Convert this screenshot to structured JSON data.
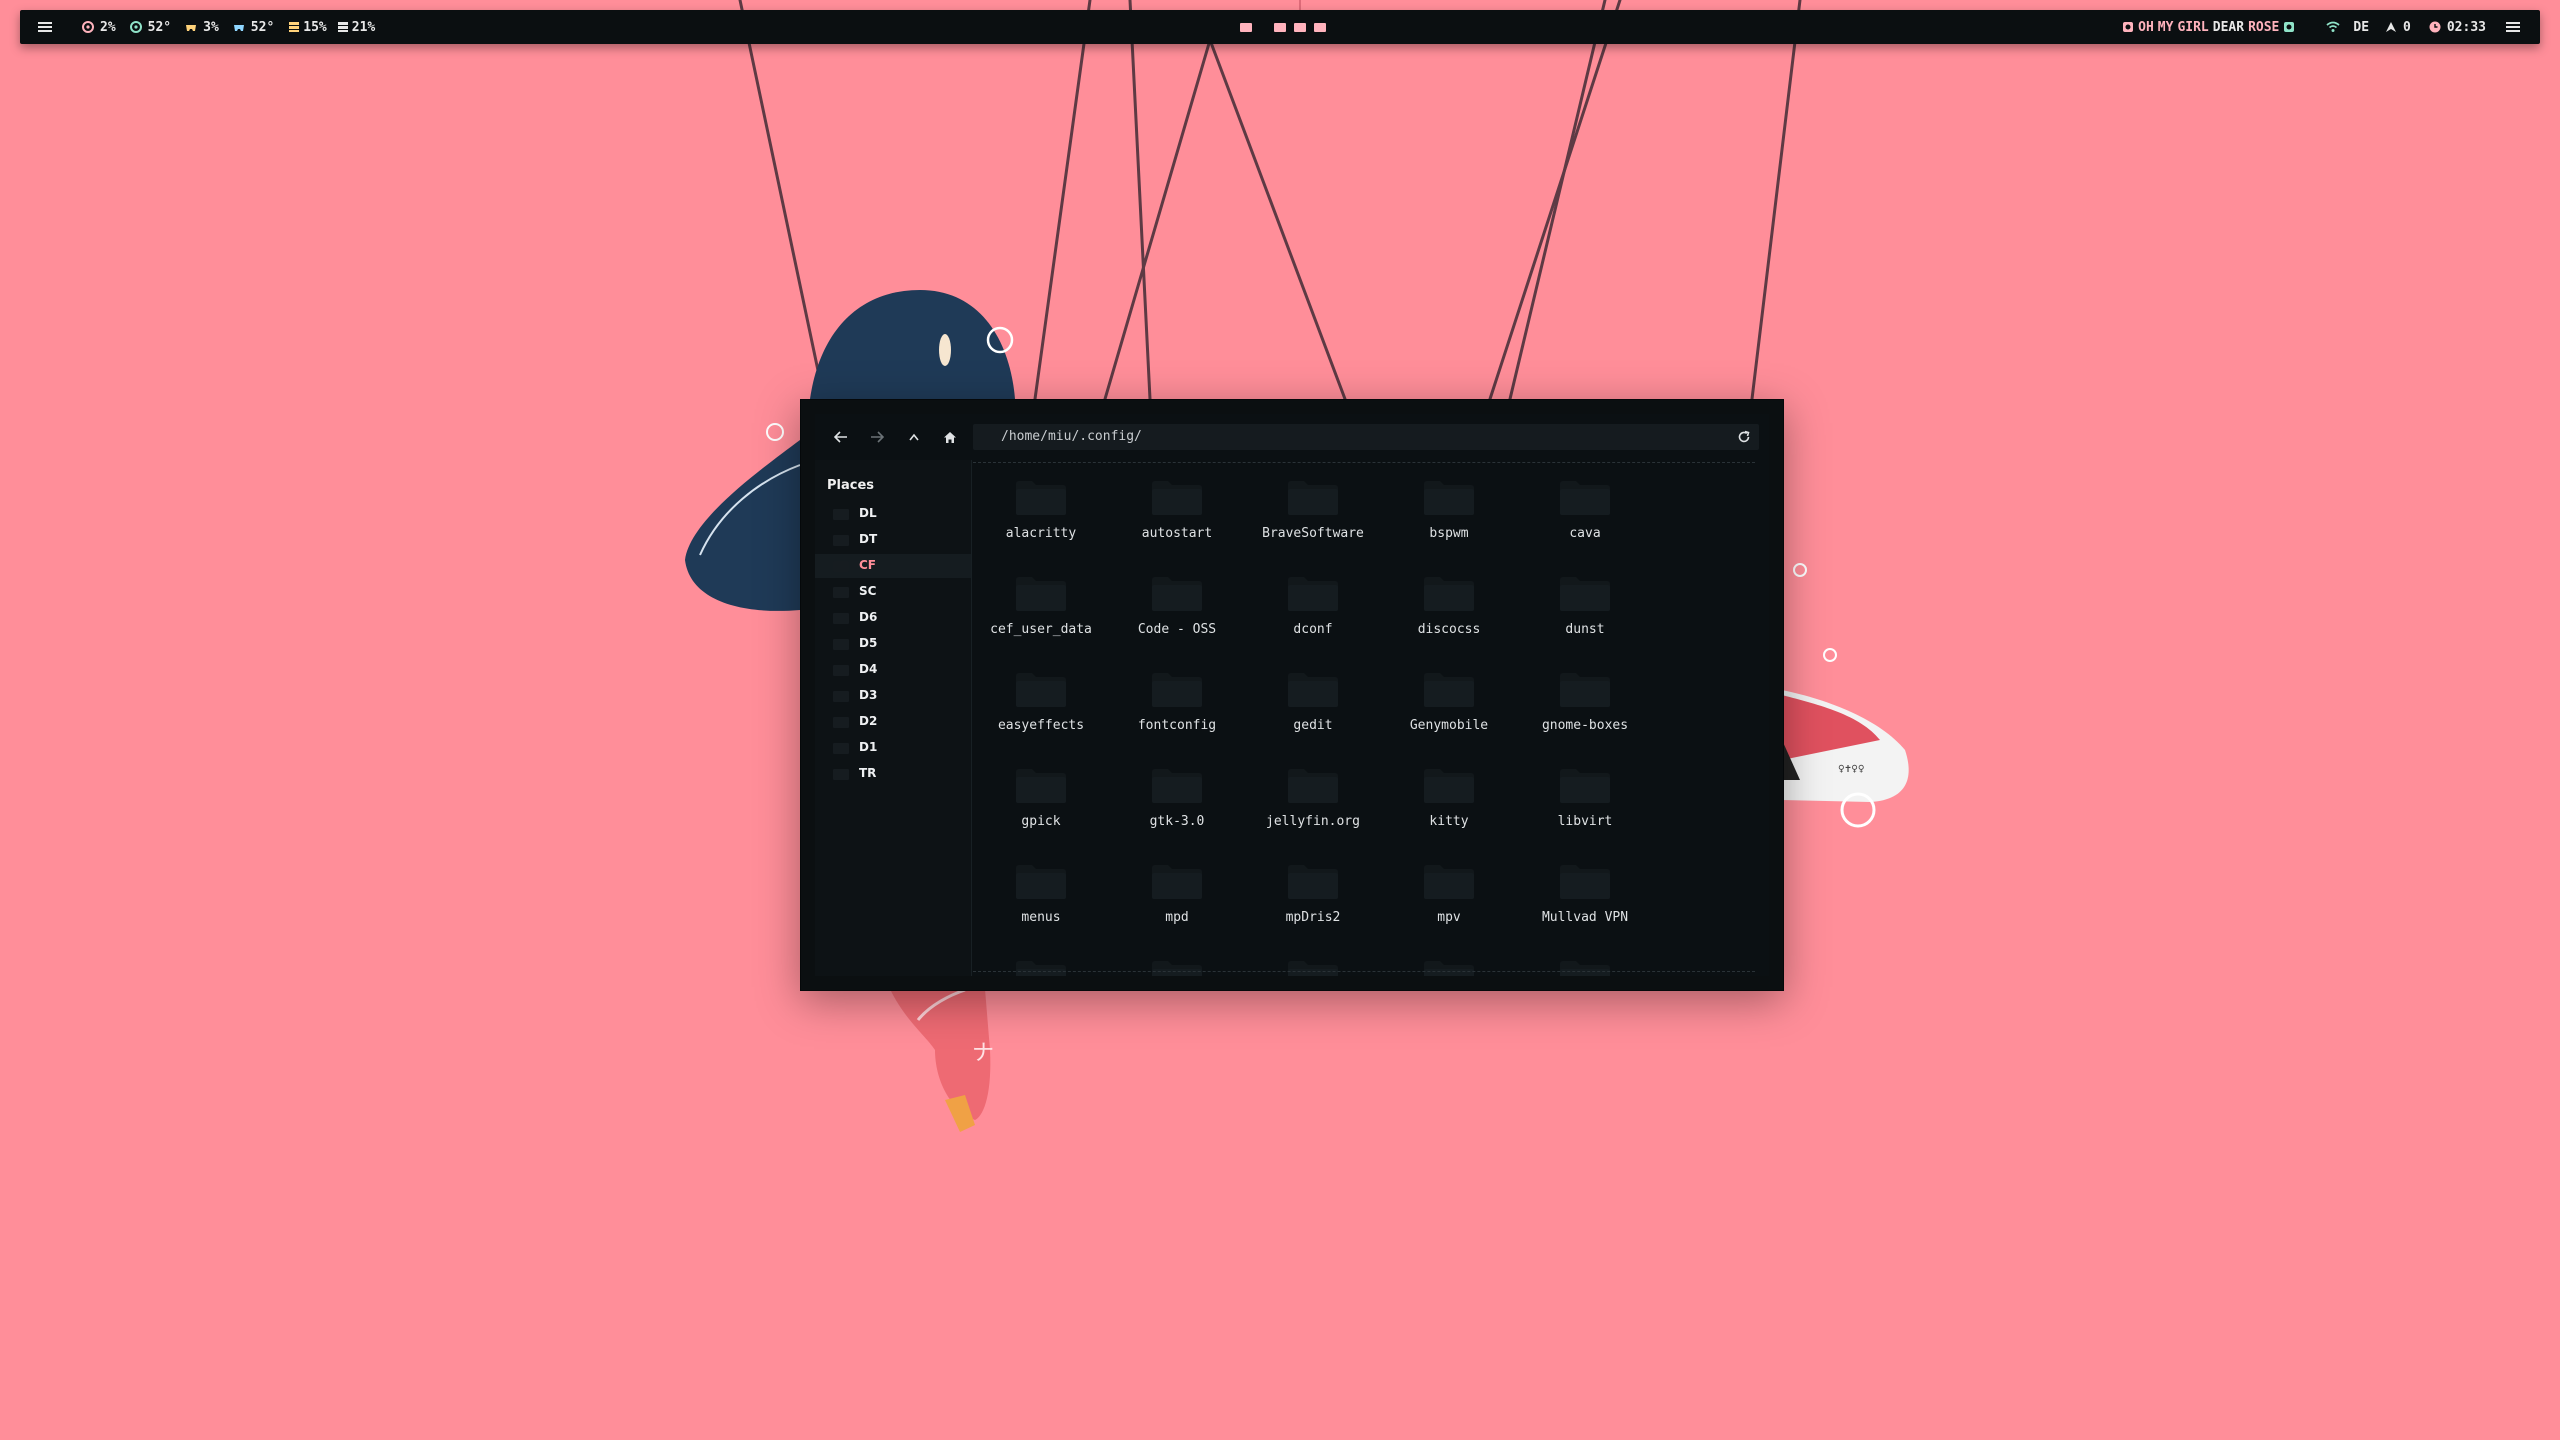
{
  "topbar": {
    "stats": [
      {
        "icon": "cpu-icon",
        "value": "2%"
      },
      {
        "icon": "cpu-temp-icon",
        "value": "52°"
      },
      {
        "icon": "gpu-icon",
        "value": "3%"
      },
      {
        "icon": "gpu-temp-icon",
        "value": "52°"
      },
      {
        "icon": "memory-icon",
        "value": "15%"
      },
      {
        "icon": "disk-icon",
        "value": "21%"
      }
    ],
    "workspaces": 4,
    "active_workspace": 1,
    "song": {
      "words": [
        "OH",
        "MY",
        "GIRL",
        "DEAR",
        "ROSE"
      ]
    },
    "network_icon": "wifi-icon",
    "keyboard_layout": "DE",
    "updates": "0",
    "clock": "02:33",
    "accent": "#ffb3bd"
  },
  "filemanager": {
    "path": "/home/miu/.config/",
    "places_title": "Places",
    "places": [
      "DL",
      "DT",
      "CF",
      "SC",
      "D6",
      "D5",
      "D4",
      "D3",
      "D2",
      "D1",
      "TR"
    ],
    "active_place": "CF",
    "folders": [
      "alacritty",
      "autostart",
      "BraveSoftware",
      "bspwm",
      "cava",
      "cef_user_data",
      "Code - OSS",
      "dconf",
      "discocss",
      "dunst",
      "easyeffects",
      "fontconfig",
      "gedit",
      "Genymobile",
      "gnome-boxes",
      "gpick",
      "gtk-3.0",
      "jellyfin.org",
      "kitty",
      "libvirt",
      "menus",
      "mpd",
      "mpDris2",
      "mpv",
      "Mullvad VPN"
    ],
    "colors": {
      "window_bg": "#0b0f11",
      "accent": "#ff8e99",
      "folder": "#12181b"
    }
  },
  "wallpaper": {
    "background": "#ff8e99",
    "glyph": "ナ"
  }
}
